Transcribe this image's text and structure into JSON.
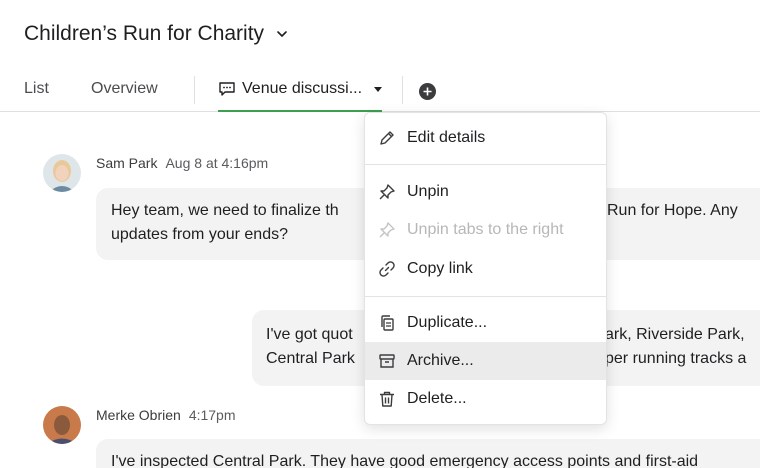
{
  "project": {
    "title": "Children’s Run for Charity"
  },
  "tabs": [
    {
      "label": "List"
    },
    {
      "label": "Overview"
    },
    {
      "label": "Venue discussi..."
    }
  ],
  "messages": [
    {
      "author": "Sam Park",
      "time": "Aug 8 at 4:16pm",
      "lines": [
        "Hey team, we need to finalize th",
        "Run for Hope. Any",
        "updates from your ends?"
      ]
    },
    {
      "lines": [
        "I've got quot",
        "ark, Riverside Park,",
        "Central Park",
        "per running tracks a"
      ]
    },
    {
      "author": "Merke Obrien",
      "time": "4:17pm",
      "lines": [
        "I've inspected Central Park. They have good emergency access points and first-aid"
      ]
    }
  ],
  "menu": {
    "items": [
      {
        "label": "Edit details",
        "icon": "pencil-icon"
      },
      {
        "label": "Unpin",
        "icon": "pin-icon"
      },
      {
        "label": "Unpin tabs to the right",
        "icon": "pin-icon",
        "disabled": true
      },
      {
        "label": "Copy link",
        "icon": "link-icon"
      },
      {
        "label": "Duplicate...",
        "icon": "duplicate-icon"
      },
      {
        "label": "Archive...",
        "icon": "archive-icon",
        "highlighted": true
      },
      {
        "label": "Delete...",
        "icon": "trash-icon"
      }
    ]
  },
  "colors": {
    "active_tab_underline": "#3d9f4f",
    "menu_hover": "#ebebeb",
    "bubble": "#f3f3f3"
  }
}
